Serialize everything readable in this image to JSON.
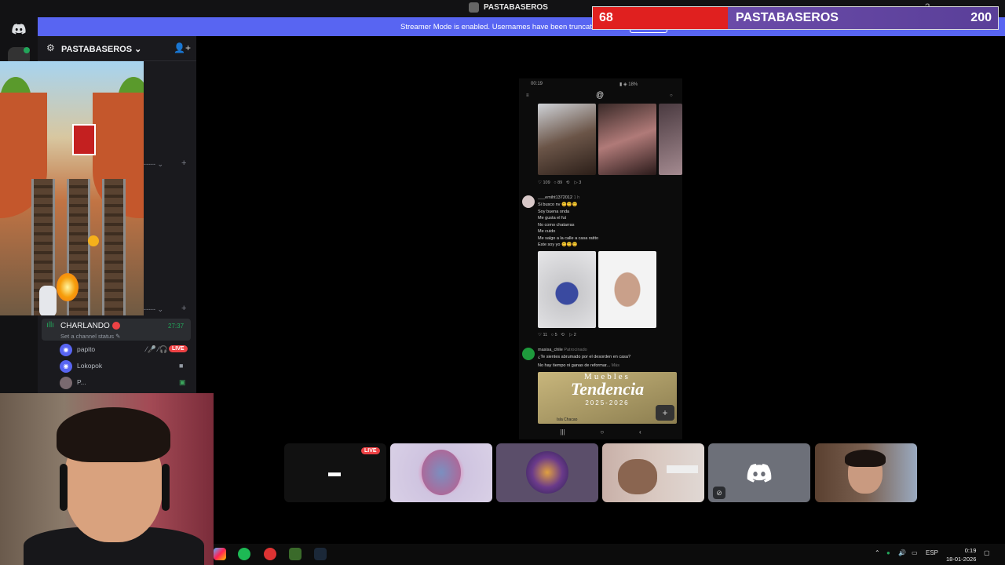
{
  "window": {
    "title": "PASTABASEROS"
  },
  "banner": {
    "text": "Streamer Mode is enabled. Usernames have been truncated."
  },
  "score": {
    "left_value": "68",
    "team": "PASTABASEROS",
    "right_value": "200",
    "colors": {
      "left": "#e0201f",
      "right": "#6a4ba8"
    }
  },
  "server": {
    "name": "PASTABASEROS"
  },
  "voice": {
    "channel_name": "CHARLANDO",
    "timer": "27:37",
    "status_placeholder": "Set a channel status",
    "users": [
      {
        "name": "papito",
        "badge": "LIVE"
      },
      {
        "name": "Lokopok",
        "badge": ""
      },
      {
        "name": "P...",
        "badge": ""
      }
    ]
  },
  "phone": {
    "status_time": "00:19",
    "battery": "18%",
    "post1": {
      "likes": "109",
      "comments": "89",
      "shares": "3"
    },
    "post2": {
      "user": "___emiht1372012",
      "time": "1 h",
      "lines": [
        "Si busco nv 😊😊😊",
        "Soy buena onda",
        "Me gusta el fut",
        "No como chatarras",
        "Me cuido",
        "Me salgo a la calle a casa ratito",
        "Este soy yo 😊😊😊"
      ],
      "likes": "11",
      "comments": "5",
      "shares": "2"
    },
    "ad": {
      "user": "masisa_chile",
      "tag": "Patrocinado",
      "line1": "¿Te sientes abrumado por el desorden en casa?",
      "line2": "No hay tiempo ni ganas de reformar...",
      "more": "Más",
      "title_top": "Muebles",
      "title_main": "Tendencia",
      "title_years": "2025-2026",
      "credit": "Isla Chacao"
    }
  },
  "tiles": {
    "live_label": "LIVE"
  },
  "taskbar": {
    "lang": "ESP",
    "time": "0:19",
    "date": "18-01-2026"
  }
}
